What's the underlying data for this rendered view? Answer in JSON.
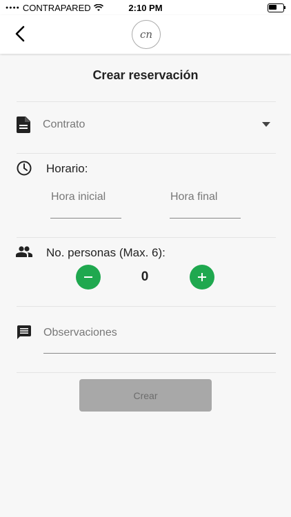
{
  "status_bar": {
    "carrier": "CONTRAPARED",
    "time": "2:10 PM"
  },
  "header": {
    "logo_text": "cn"
  },
  "page_title": "Crear reservación",
  "contract": {
    "placeholder": "Contrato"
  },
  "schedule": {
    "label": "Horario:",
    "start_placeholder": "Hora inicial",
    "end_placeholder": "Hora final"
  },
  "people": {
    "label": "No. personas (Max. 6):",
    "value": "0"
  },
  "notes": {
    "placeholder": "Observaciones"
  },
  "submit": {
    "label": "Crear"
  },
  "colors": {
    "accent": "#1fa84f",
    "button_disabled": "#a8a8a8"
  },
  "icons": [
    "back-chevron-icon",
    "document-icon",
    "dropdown-arrow-icon",
    "clock-icon",
    "people-icon",
    "minus-icon",
    "plus-icon",
    "comment-icon"
  ]
}
